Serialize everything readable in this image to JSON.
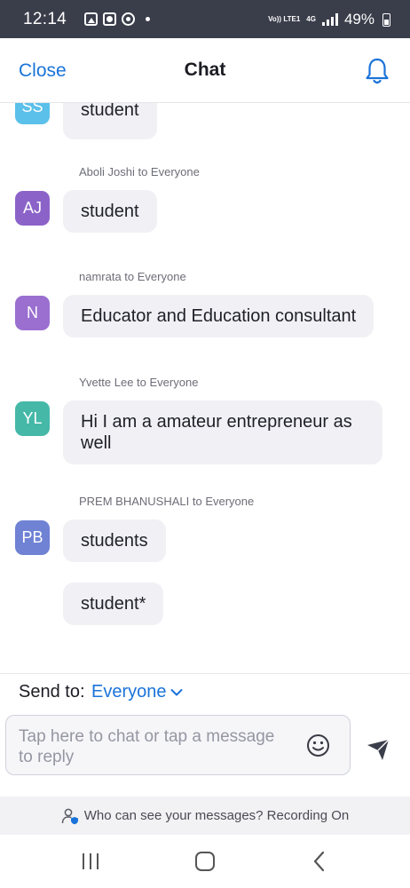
{
  "status_bar": {
    "time": "12:14",
    "network_label": "Vo)) LTE1",
    "network_type": "4G",
    "battery": "49%"
  },
  "header": {
    "close_label": "Close",
    "title": "Chat"
  },
  "messages": [
    {
      "avatar": "SS",
      "avatar_color": "#5bc0ea",
      "sender": "",
      "texts": [
        "student"
      ]
    },
    {
      "avatar": "AJ",
      "avatar_color": "#8b63c8",
      "sender": "Aboli Joshi to Everyone",
      "texts": [
        "student"
      ]
    },
    {
      "avatar": "N",
      "avatar_color": "#9a6fd0",
      "sender": "namrata to Everyone",
      "texts": [
        "Educator and Education consultant"
      ]
    },
    {
      "avatar": "YL",
      "avatar_color": "#45b8a8",
      "sender": "Yvette Lee to Everyone",
      "texts": [
        "Hi I am a amateur entrepreneur as well"
      ]
    },
    {
      "avatar": "PB",
      "avatar_color": "#6f82d4",
      "sender": "PREM BHANUSHALI to Everyone",
      "texts": [
        "students",
        "student*"
      ]
    }
  ],
  "send_to": {
    "label": "Send to:",
    "value": "Everyone"
  },
  "composer": {
    "placeholder": "Tap here to chat or tap a message to reply"
  },
  "privacy": {
    "text": "Who can see your messages? Recording On"
  },
  "colors": {
    "accent": "#1a73d9",
    "bubble": "#f1f1f5",
    "status_bar": "#3a3d4a"
  }
}
